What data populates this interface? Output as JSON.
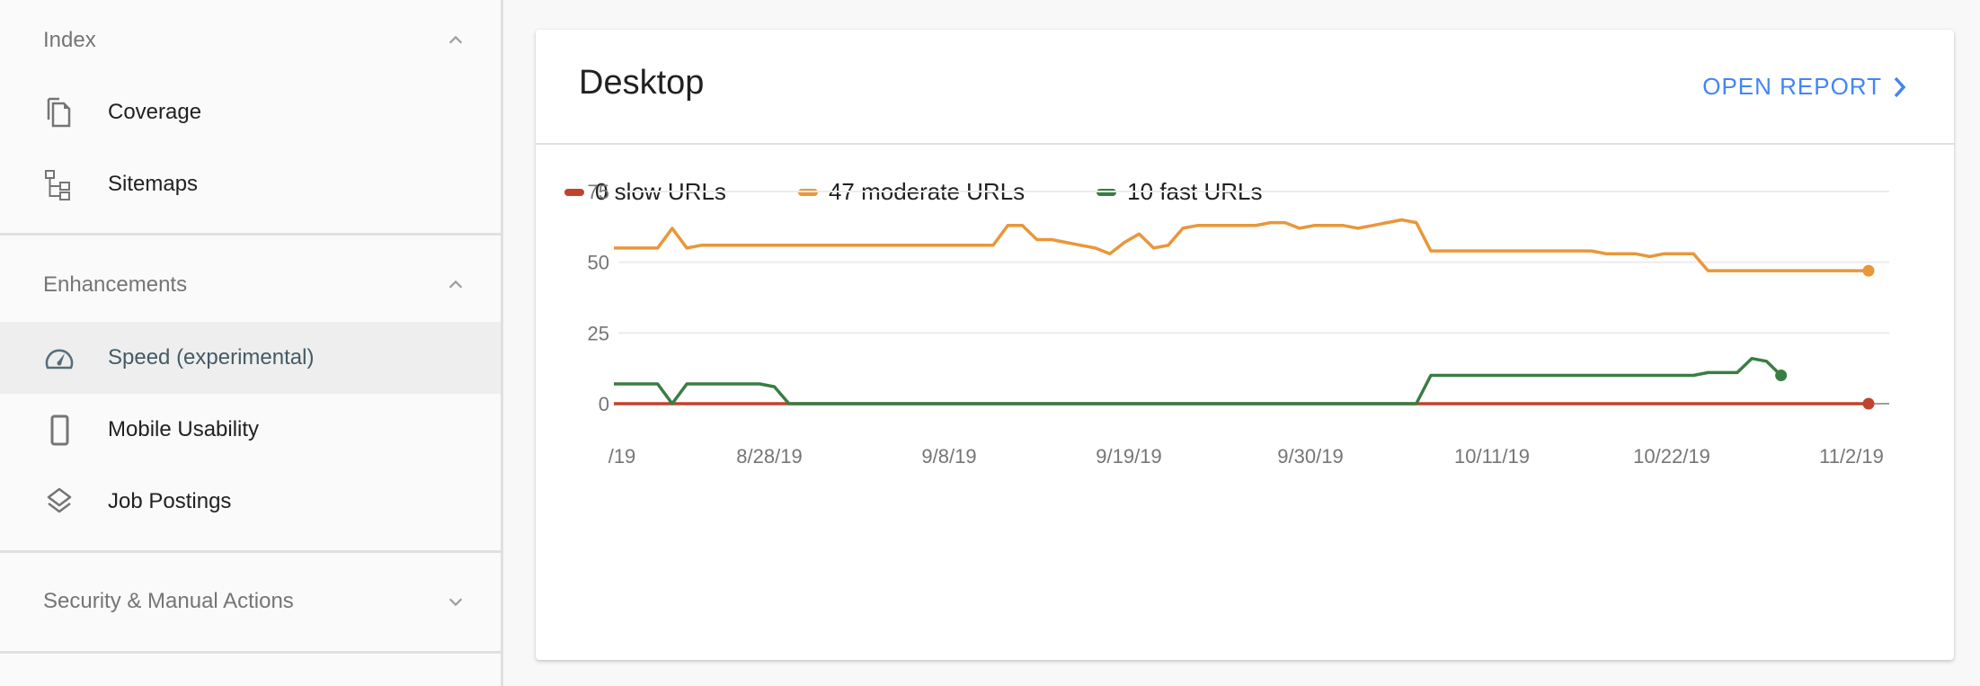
{
  "sidebar": {
    "sections": [
      {
        "title": "Index",
        "expanded": true,
        "items": [
          {
            "label": "Coverage",
            "icon": "coverage-icon"
          },
          {
            "label": "Sitemaps",
            "icon": "sitemaps-icon"
          }
        ]
      },
      {
        "title": "Enhancements",
        "expanded": true,
        "items": [
          {
            "label": "Speed (experimental)",
            "icon": "speed-gauge-icon",
            "active": true
          },
          {
            "label": "Mobile Usability",
            "icon": "mobile-phone-icon"
          },
          {
            "label": "Job Postings",
            "icon": "layers-icon"
          }
        ]
      },
      {
        "title": "Security & Manual Actions",
        "expanded": false,
        "items": []
      }
    ]
  },
  "card": {
    "title": "Desktop",
    "open_report_label": "OPEN REPORT",
    "legend": [
      {
        "label": "0 slow URLs",
        "color": "#c0432f"
      },
      {
        "label": "47 moderate URLs",
        "color": "#e8973a"
      },
      {
        "label": "10 fast URLs",
        "color": "#3a7d44"
      }
    ]
  },
  "chart_data": {
    "type": "line",
    "title": "Desktop",
    "xlabel": "",
    "ylabel": "",
    "ylim": [
      0,
      75
    ],
    "yticks": [
      0,
      25,
      50,
      75
    ],
    "xtick_labels": [
      "/19",
      "8/28/19",
      "9/8/19",
      "9/19/19",
      "9/30/19",
      "10/11/19",
      "10/22/19",
      "11/2/19"
    ],
    "grid": true,
    "legend_position": "top-left",
    "series": [
      {
        "name": "slow URLs",
        "color": "#c0432f",
        "keypoints": [
          [
            0,
            0
          ],
          [
            86,
            0
          ]
        ]
      },
      {
        "name": "moderate URLs",
        "color": "#e8973a",
        "keypoints": [
          [
            0,
            55
          ],
          [
            3,
            55
          ],
          [
            4,
            62
          ],
          [
            5,
            55
          ],
          [
            6,
            56
          ],
          [
            26,
            56
          ],
          [
            27,
            63
          ],
          [
            28,
            63
          ],
          [
            29,
            58
          ],
          [
            30,
            58
          ],
          [
            33,
            55
          ],
          [
            34,
            53
          ],
          [
            35,
            57
          ],
          [
            36,
            60
          ],
          [
            37,
            55
          ],
          [
            38,
            56
          ],
          [
            39,
            62
          ],
          [
            40,
            63
          ],
          [
            44,
            63
          ],
          [
            45,
            64
          ],
          [
            46,
            64
          ],
          [
            47,
            62
          ],
          [
            48,
            63
          ],
          [
            50,
            63
          ],
          [
            51,
            62
          ],
          [
            54,
            65
          ],
          [
            55,
            64
          ],
          [
            56,
            54
          ],
          [
            67,
            54
          ],
          [
            68,
            53
          ],
          [
            70,
            53
          ],
          [
            71,
            52
          ],
          [
            72,
            53
          ],
          [
            74,
            53
          ],
          [
            75,
            47
          ],
          [
            86,
            47
          ]
        ]
      },
      {
        "name": "fast URLs",
        "color": "#3a7d44",
        "keypoints": [
          [
            0,
            7
          ],
          [
            3,
            7
          ],
          [
            4,
            0
          ],
          [
            5,
            7
          ],
          [
            10,
            7
          ],
          [
            11,
            6
          ],
          [
            12,
            0
          ],
          [
            55,
            0
          ],
          [
            56,
            10
          ],
          [
            74,
            10
          ],
          [
            75,
            11
          ],
          [
            77,
            11
          ],
          [
            78,
            16
          ],
          [
            79,
            15
          ],
          [
            80,
            10
          ]
        ]
      }
    ],
    "num_points": 87,
    "final_values": {
      "slow": 0,
      "moderate": 47,
      "fast": 10
    }
  }
}
